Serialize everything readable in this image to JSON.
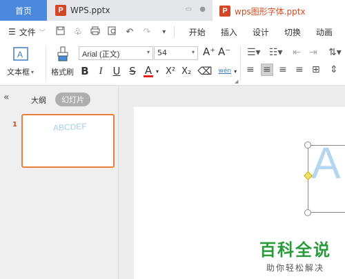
{
  "tabs": {
    "home": "首页",
    "doc1": "WPS.pptx",
    "doc2": "wps图形字体.pptx",
    "badge": "P"
  },
  "menu": {
    "file": "文件",
    "items": [
      "开始",
      "插入",
      "设计",
      "切换",
      "动画"
    ]
  },
  "ribbon": {
    "textbox": "文本框",
    "format_painter": "格式刷",
    "font_name": "Arial (正文)",
    "font_size": "54",
    "bold": "B",
    "italic": "I",
    "underline": "U",
    "strike": "S",
    "font_color": "A",
    "superscript": "X²",
    "subscript": "X₂",
    "phonetic": "wén",
    "grow": "A⁺",
    "shrink": "A⁻"
  },
  "panel": {
    "outline": "大纲",
    "slides": "幻灯片",
    "slide_number": "1",
    "thumb_text": "ABCDEF"
  },
  "canvas": {
    "letter": "A"
  },
  "watermark": {
    "line1": "百科全说",
    "line2": "助你轻松解决"
  },
  "colors": {
    "accent": "#4a89dc",
    "wps_orange": "#d04a1f",
    "thumb_border": "#e87d3e",
    "letter": "#b4d6ef",
    "watermark_green": "#2a9a3c"
  }
}
